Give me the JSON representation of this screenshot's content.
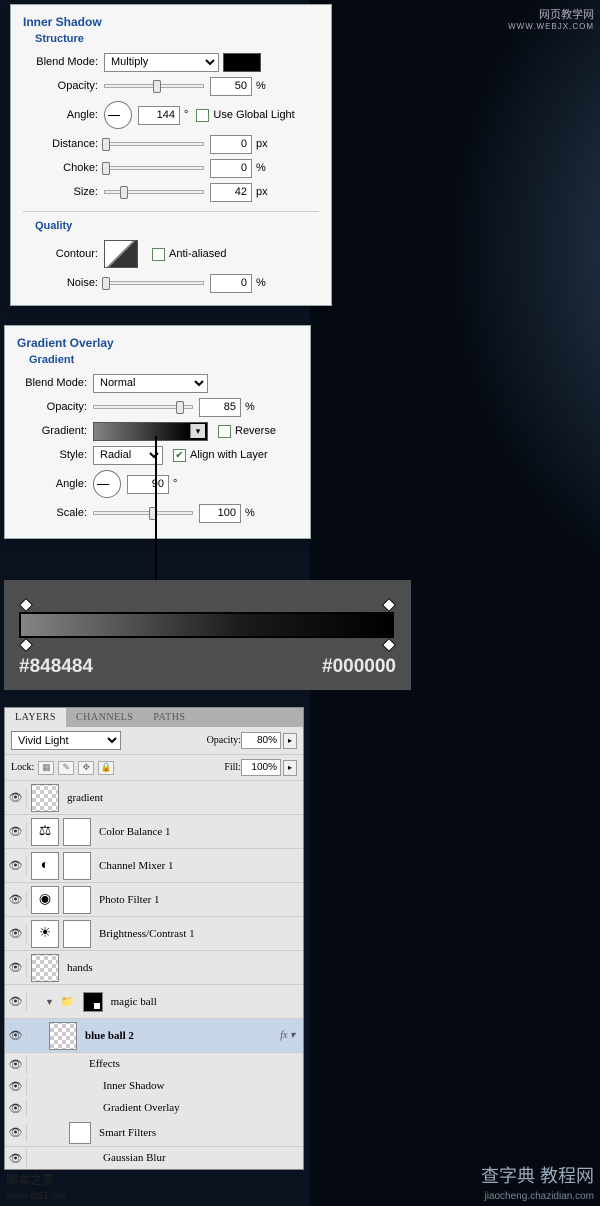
{
  "brand": {
    "line1": "网页教学网",
    "line2": "WWW.WEBJX.COM"
  },
  "inner_shadow": {
    "title": "Inner Shadow",
    "structure": "Structure",
    "blend_mode_label": "Blend Mode:",
    "blend_mode": "Multiply",
    "opacity_label": "Opacity:",
    "opacity": "50",
    "angle_label": "Angle:",
    "angle": "144",
    "angle_unit": "°",
    "global_light": "Use Global Light",
    "distance_label": "Distance:",
    "distance": "0",
    "px": "px",
    "choke_label": "Choke:",
    "choke": "0",
    "pct": "%",
    "size_label": "Size:",
    "size": "42",
    "quality": "Quality",
    "contour_label": "Contour:",
    "anti_aliased": "Anti-aliased",
    "noise_label": "Noise:",
    "noise": "0"
  },
  "gradient_overlay": {
    "title": "Gradient Overlay",
    "gradient_h": "Gradient",
    "blend_mode_label": "Blend Mode:",
    "blend_mode": "Normal",
    "opacity_label": "Opacity:",
    "opacity": "85",
    "pct": "%",
    "gradient_label": "Gradient:",
    "reverse": "Reverse",
    "style_label": "Style:",
    "style": "Radial",
    "align": "Align with Layer",
    "angle_label": "Angle:",
    "angle": "90",
    "angle_unit": "°",
    "scale_label": "Scale:",
    "scale": "100"
  },
  "gradient_stops": {
    "left": "#848484",
    "right": "#000000"
  },
  "layers": {
    "tabs": [
      "LAYERS",
      "CHANNELS",
      "PATHS"
    ],
    "blend_mode": "Vivid Light",
    "opacity_label": "Opacity:",
    "opacity": "80%",
    "lock_label": "Lock:",
    "fill_label": "Fill:",
    "fill": "100%",
    "items": [
      {
        "name": "gradient",
        "thumb": "checker"
      },
      {
        "name": "Color Balance 1",
        "adj": "⚖"
      },
      {
        "name": "Channel Mixer 1",
        "adj": "◐"
      },
      {
        "name": "Photo Filter 1",
        "adj": "◉"
      },
      {
        "name": "Brightness/Contrast 1",
        "adj": "☀"
      },
      {
        "name": "hands",
        "thumb": "checker"
      }
    ],
    "group": {
      "name": "magic ball"
    },
    "selected": {
      "name": "blue ball 2"
    },
    "effects_label": "Effects",
    "effect1": "Inner Shadow",
    "effect2": "Gradient Overlay",
    "smart_filters": "Smart Filters",
    "gaussian": "Gaussian Blur"
  },
  "footer": {
    "left": "脚本之家",
    "left2": "www.jb51.net",
    "right1": "查字典 教程网",
    "right2": "jiaocheng.chazidian.com"
  }
}
